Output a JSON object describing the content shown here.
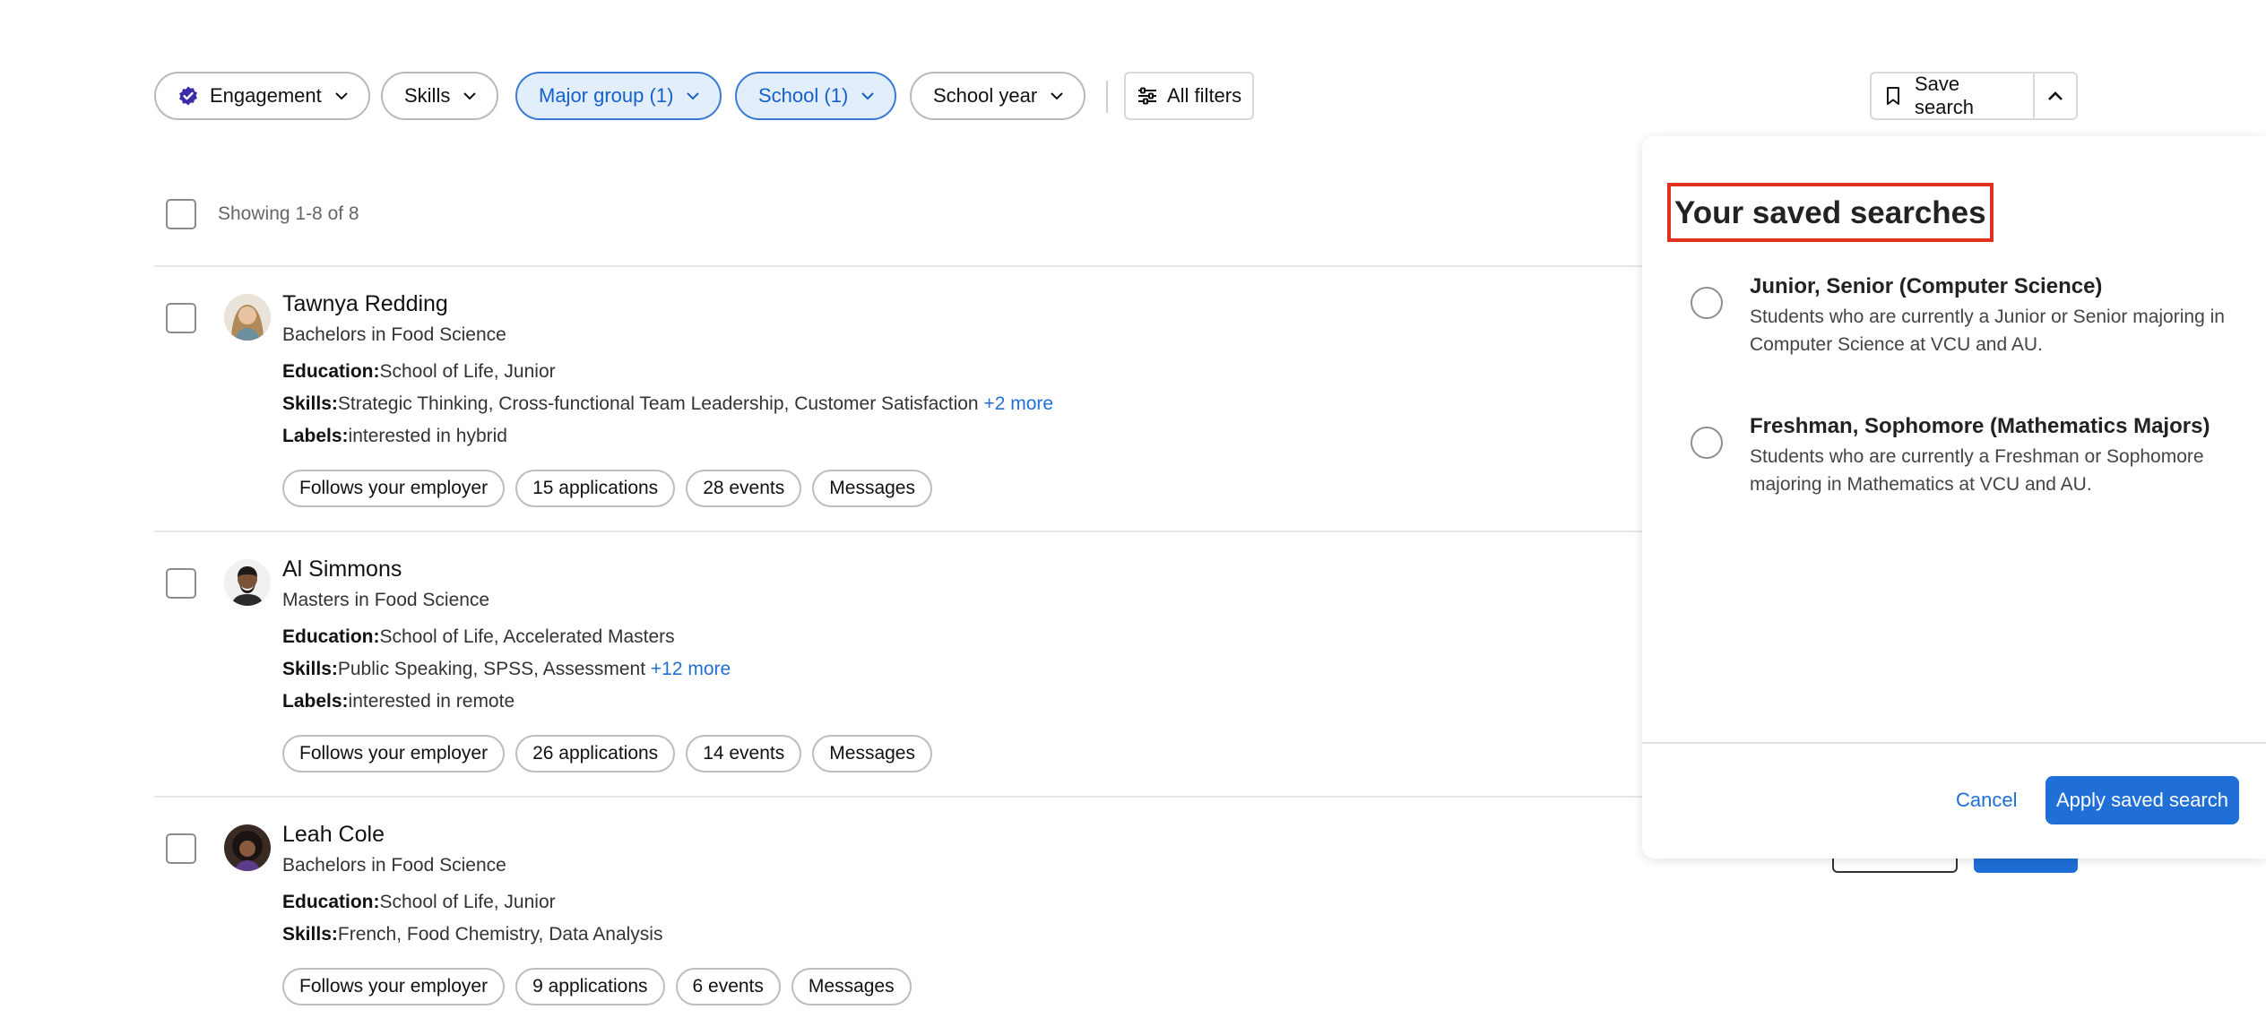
{
  "filters": {
    "engagement": "Engagement",
    "skills": "Skills",
    "major_group": "Major group (1)",
    "school": "School (1)",
    "school_year": "School year",
    "all_filters": "All filters",
    "save_search": "Save search"
  },
  "results": {
    "showing": "Showing 1-8 of 8"
  },
  "labels": {
    "education": "Education:",
    "skills": "Skills:",
    "labels": "Labels:"
  },
  "students": [
    {
      "name": "Tawnya Redding",
      "degree": "Bachelors in Food Science",
      "education": "School of Life, Junior",
      "skills": "Strategic Thinking, Cross-functional Team Leadership, Customer Satisfaction",
      "more": "+2 more",
      "labels": "interested in hybrid",
      "tags": [
        "Follows your employer",
        "15 applications",
        "28 events",
        "Messages"
      ]
    },
    {
      "name": "Al Simmons",
      "degree": "Masters in Food Science",
      "education": "School of Life, Accelerated Masters",
      "skills": "Public Speaking, SPSS, Assessment",
      "more": "+12 more",
      "labels": "interested in remote",
      "tags": [
        "Follows your employer",
        "26 applications",
        "14 events",
        "Messages"
      ]
    },
    {
      "name": "Leah Cole",
      "degree": "Bachelors in Food Science",
      "education": "School of Life, Junior",
      "skills": "French, Food Chemistry, Data Analysis",
      "tags": [
        "Follows your employer",
        "9 applications",
        "6 events",
        "Messages"
      ]
    }
  ],
  "panel": {
    "title": "Your saved searches",
    "searches": [
      {
        "title": "Junior, Senior (Computer Science)",
        "description": "Students who are currently a Junior or Senior majoring in Computer Science at VCU and AU."
      },
      {
        "title": "Freshman, Sophomore (Mathematics Majors)",
        "description": "Students who are currently a Freshman or Sophomore majoring in Mathematics at VCU and AU."
      }
    ],
    "cancel": "Cancel",
    "apply": "Apply saved search"
  },
  "colors": {
    "accent": "#1f6fd6",
    "active_pill_bg": "#e3eefb",
    "highlight_border": "#e0301e",
    "verified_badge": "#3a2ba8"
  }
}
